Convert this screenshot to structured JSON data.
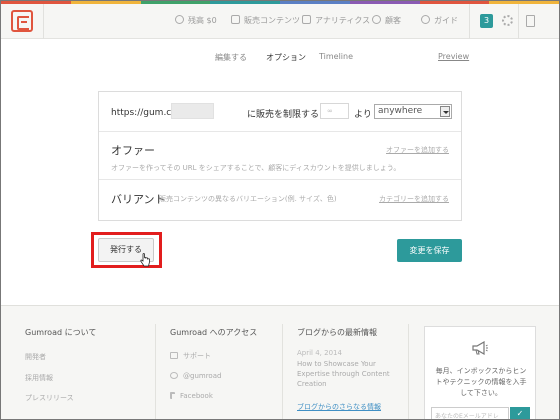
{
  "colors": {
    "accent": "#2d9a9b",
    "highlight": "#e21d1d",
    "brand": "#e0553e",
    "colorbar": [
      "#e0553e",
      "#f0b43b",
      "#3fa26a",
      "#2d9a9b",
      "#5a7fc4",
      "#8a5ab3",
      "#e0553e",
      "#f0b43b"
    ]
  },
  "topnav": {
    "items": [
      {
        "icon": "money-icon",
        "label": "残高 $0"
      },
      {
        "icon": "products-icon",
        "label": "販売コンテンツ"
      },
      {
        "icon": "analytics-icon",
        "label": "アナリティクス"
      },
      {
        "icon": "customers-icon",
        "label": "顧客"
      },
      {
        "icon": "guide-icon",
        "label": "ガイド"
      }
    ],
    "notification_count": "3",
    "icons": [
      "gear-icon",
      "document-icon"
    ]
  },
  "tabs": [
    {
      "label": "編集する"
    },
    {
      "label": "オプション",
      "active": true
    },
    {
      "label": "Timeline"
    }
  ],
  "preview_link": "Preview",
  "options": {
    "url_prefix": "https://gum.co/",
    "url_value": "",
    "restrict_label": "に販売を制限する",
    "count_placeholder": "∞",
    "yori": "より",
    "region_value": "anywhere",
    "offer": {
      "title": "オファー",
      "description": "オファーを作ってその URL をシェアすることで、顧客にディスカウントを提供しましょう。",
      "link": "オファーを追加する"
    },
    "variants": {
      "title": "バリアント",
      "description": "販売コンテンツの異なるバリエーション(例. サイズ、色)",
      "link": "カテゴリーを追加する"
    }
  },
  "actions": {
    "publish": "発行する",
    "save": "変更を保存"
  },
  "footer": {
    "about": {
      "title": "Gumroad について",
      "items": [
        "開発者",
        "採用情報",
        "プレスリリース"
      ]
    },
    "access": {
      "title": "Gumroad へのアクセス",
      "items": [
        {
          "icon": "mail-icon",
          "label": "サポート"
        },
        {
          "icon": "at-icon",
          "label": "@gumroad"
        },
        {
          "icon": "facebook-icon",
          "label": "Facebook"
        }
      ]
    },
    "blog": {
      "title": "ブログからの最新情報",
      "date": "April 4, 2014",
      "post": "How to Showcase Your Expertise through Content Creation",
      "more": "ブログからのさらなる情報"
    },
    "newsletter": {
      "text": "毎月、インボックスからヒントやテクニックの情報を入手して下さい。",
      "email_placeholder": "あなたのEメールアドレ",
      "submit": "✓"
    }
  }
}
